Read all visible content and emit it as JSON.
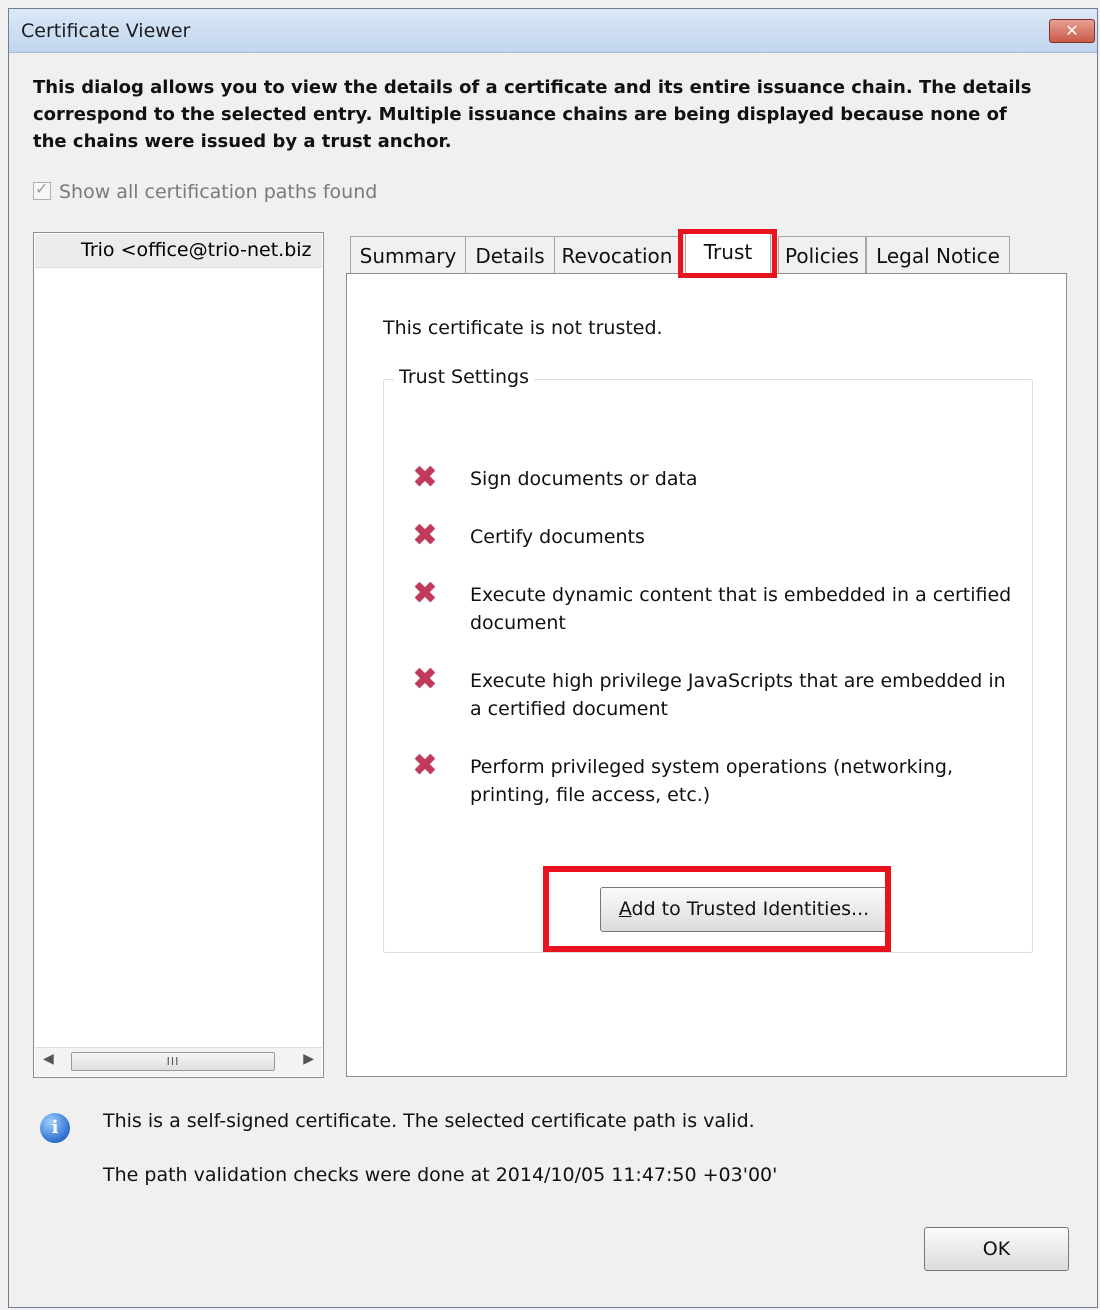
{
  "window": {
    "title": "Certificate Viewer",
    "close_glyph": "✕"
  },
  "intro_text": "This dialog allows you to view the details of a certificate and its entire issuance chain. The details correspond to the selected entry. Multiple issuance chains are being displayed because none of the chains were issued by a trust anchor.",
  "show_all_paths": {
    "label": "Show all certification paths found",
    "checked": true
  },
  "certificate_tree": {
    "items": [
      {
        "label": "Trio <office@trio-net.biz"
      }
    ],
    "scrollbar": {
      "thumb_grip": "III"
    }
  },
  "tabs": [
    {
      "label": "Summary"
    },
    {
      "label": "Details"
    },
    {
      "label": "Revocation"
    },
    {
      "label": "Trust",
      "active": true
    },
    {
      "label": "Policies"
    },
    {
      "label": "Legal Notice"
    }
  ],
  "trust_tab": {
    "status": "This certificate is not trusted.",
    "group_label": "Trust Settings",
    "items": [
      {
        "icon": "x-icon",
        "text": "Sign documents or data"
      },
      {
        "icon": "x-icon",
        "text": "Certify documents"
      },
      {
        "icon": "x-icon",
        "text": "Execute dynamic content that is embedded in a certified document"
      },
      {
        "icon": "x-icon",
        "text": "Execute high privilege JavaScripts that are embedded in a certified document"
      },
      {
        "icon": "x-icon",
        "text": "Perform privileged system operations (networking, printing, file access, etc.)"
      }
    ],
    "add_button_label": "Add to Trusted Identities...",
    "add_button_mnemonic": "A"
  },
  "info": {
    "icon": "info-icon",
    "line1": "This is a self-signed certificate. The selected certificate path is valid.",
    "line2": "The path validation checks were done at 2014/10/05 11:47:50 +03'00'"
  },
  "ok_label": "OK",
  "colors": {
    "highlight": "#e8131e",
    "x_icon": "#c23a5a",
    "info_icon": "#2f6fd0"
  }
}
